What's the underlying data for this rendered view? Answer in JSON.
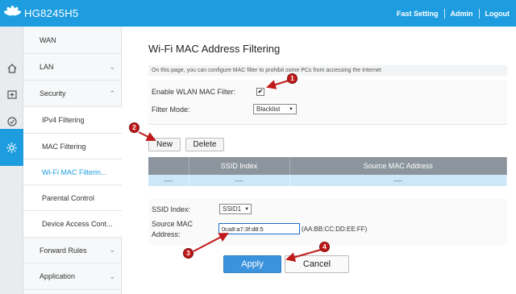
{
  "header": {
    "brand": "HG8245H5",
    "links": [
      "Fast Setting",
      "Admin",
      "Logout"
    ]
  },
  "iconbar": {
    "icons": [
      "home-icon",
      "plus-box-icon",
      "speedometer-icon",
      "gear-icon"
    ],
    "active": "gear-icon"
  },
  "nav": {
    "items": [
      {
        "label": "WAN",
        "sub": false
      },
      {
        "label": "LAN",
        "sub": false,
        "chevron": "down"
      },
      {
        "label": "Security",
        "sub": false,
        "chevron": "up"
      },
      {
        "label": "IPv4 Filtering",
        "sub": true
      },
      {
        "label": "MAC Filtering",
        "sub": true
      },
      {
        "label": "Wi-Fi MAC Filterin...",
        "sub": true,
        "selected": true
      },
      {
        "label": "Parental Control",
        "sub": true
      },
      {
        "label": "Device Access Cont...",
        "sub": true
      },
      {
        "label": "Forward Rules",
        "sub": false,
        "chevron": "down"
      },
      {
        "label": "Application",
        "sub": false,
        "chevron": "down"
      }
    ]
  },
  "main": {
    "title": "Wi-Fi MAC Address Filtering",
    "description": "On this page, you can configure MAC filter to prohibit some PCs from accessing the Internet",
    "enable_label": "Enable WLAN MAC Filter:",
    "enable_checked": true,
    "filter_mode_label": "Filter Mode:",
    "filter_mode_value": "Blacklist",
    "new_label": "New",
    "delete_label": "Delete",
    "table": {
      "headers": [
        "",
        "SSID Index",
        "Source MAC Address"
      ],
      "rows": [
        [
          "----",
          "----",
          "----"
        ]
      ]
    },
    "ssid_index_label": "SSID Index:",
    "ssid_index_value": "SSID1",
    "source_mac_label_1": "Source MAC",
    "source_mac_label_2": "Address:",
    "source_mac_value": "0ca8:a7:3f:d8:5",
    "source_mac_hint": "(AA:BB:CC:DD:EE:FF)",
    "apply_label": "Apply",
    "cancel_label": "Cancel"
  },
  "annotations": {
    "badges": [
      "1",
      "2",
      "3",
      "4"
    ],
    "color": "#c0191a"
  },
  "colors": {
    "accent": "#1d9de0",
    "apply": "#3b93dd",
    "table_header": "#8c959e",
    "table_row": "#cbe7f8"
  }
}
